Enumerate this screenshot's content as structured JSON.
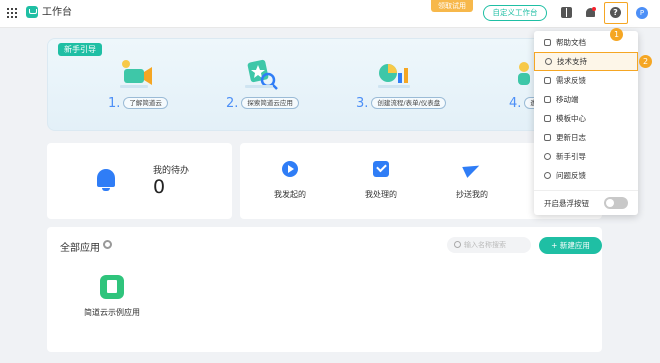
{
  "header": {
    "title": "工作台",
    "trial_label": "领取试用",
    "customize_label": "自定义工作台",
    "avatar_initial": "P"
  },
  "guide": {
    "tag": "新手引导",
    "steps": [
      {
        "num": "1.",
        "label": "了解简道云"
      },
      {
        "num": "2.",
        "label": "探索简道云应用"
      },
      {
        "num": "3.",
        "label": "创建流程/表单/仪表盘"
      },
      {
        "num": "4.",
        "label": "邀"
      }
    ]
  },
  "todo": {
    "label": "我的待办",
    "count": "0"
  },
  "actions": [
    {
      "label": "我发起的",
      "icon": "play-icon"
    },
    {
      "label": "我处理的",
      "icon": "check-icon"
    },
    {
      "label": "抄送我的",
      "icon": "send-icon"
    }
  ],
  "apps": {
    "title": "全部应用",
    "search_placeholder": "输入名称搜索",
    "new_app_label": "+ 新建应用",
    "items": [
      {
        "label": "简道云示例应用"
      }
    ]
  },
  "help_menu": {
    "items": [
      {
        "label": "帮助文档"
      },
      {
        "label": "技术支持"
      },
      {
        "label": "需求反馈"
      },
      {
        "label": "移动端"
      },
      {
        "label": "模板中心"
      },
      {
        "label": "更新日志"
      },
      {
        "label": "新手引导"
      },
      {
        "label": "问题反馈"
      }
    ],
    "toggle_label": "开启悬浮按钮",
    "toggle_on": false
  },
  "annotations": {
    "badge1": "1",
    "badge2": "2"
  },
  "colors": {
    "accent": "#1fbfa4",
    "highlight": "#f5a623",
    "primary": "#2f7df6"
  }
}
